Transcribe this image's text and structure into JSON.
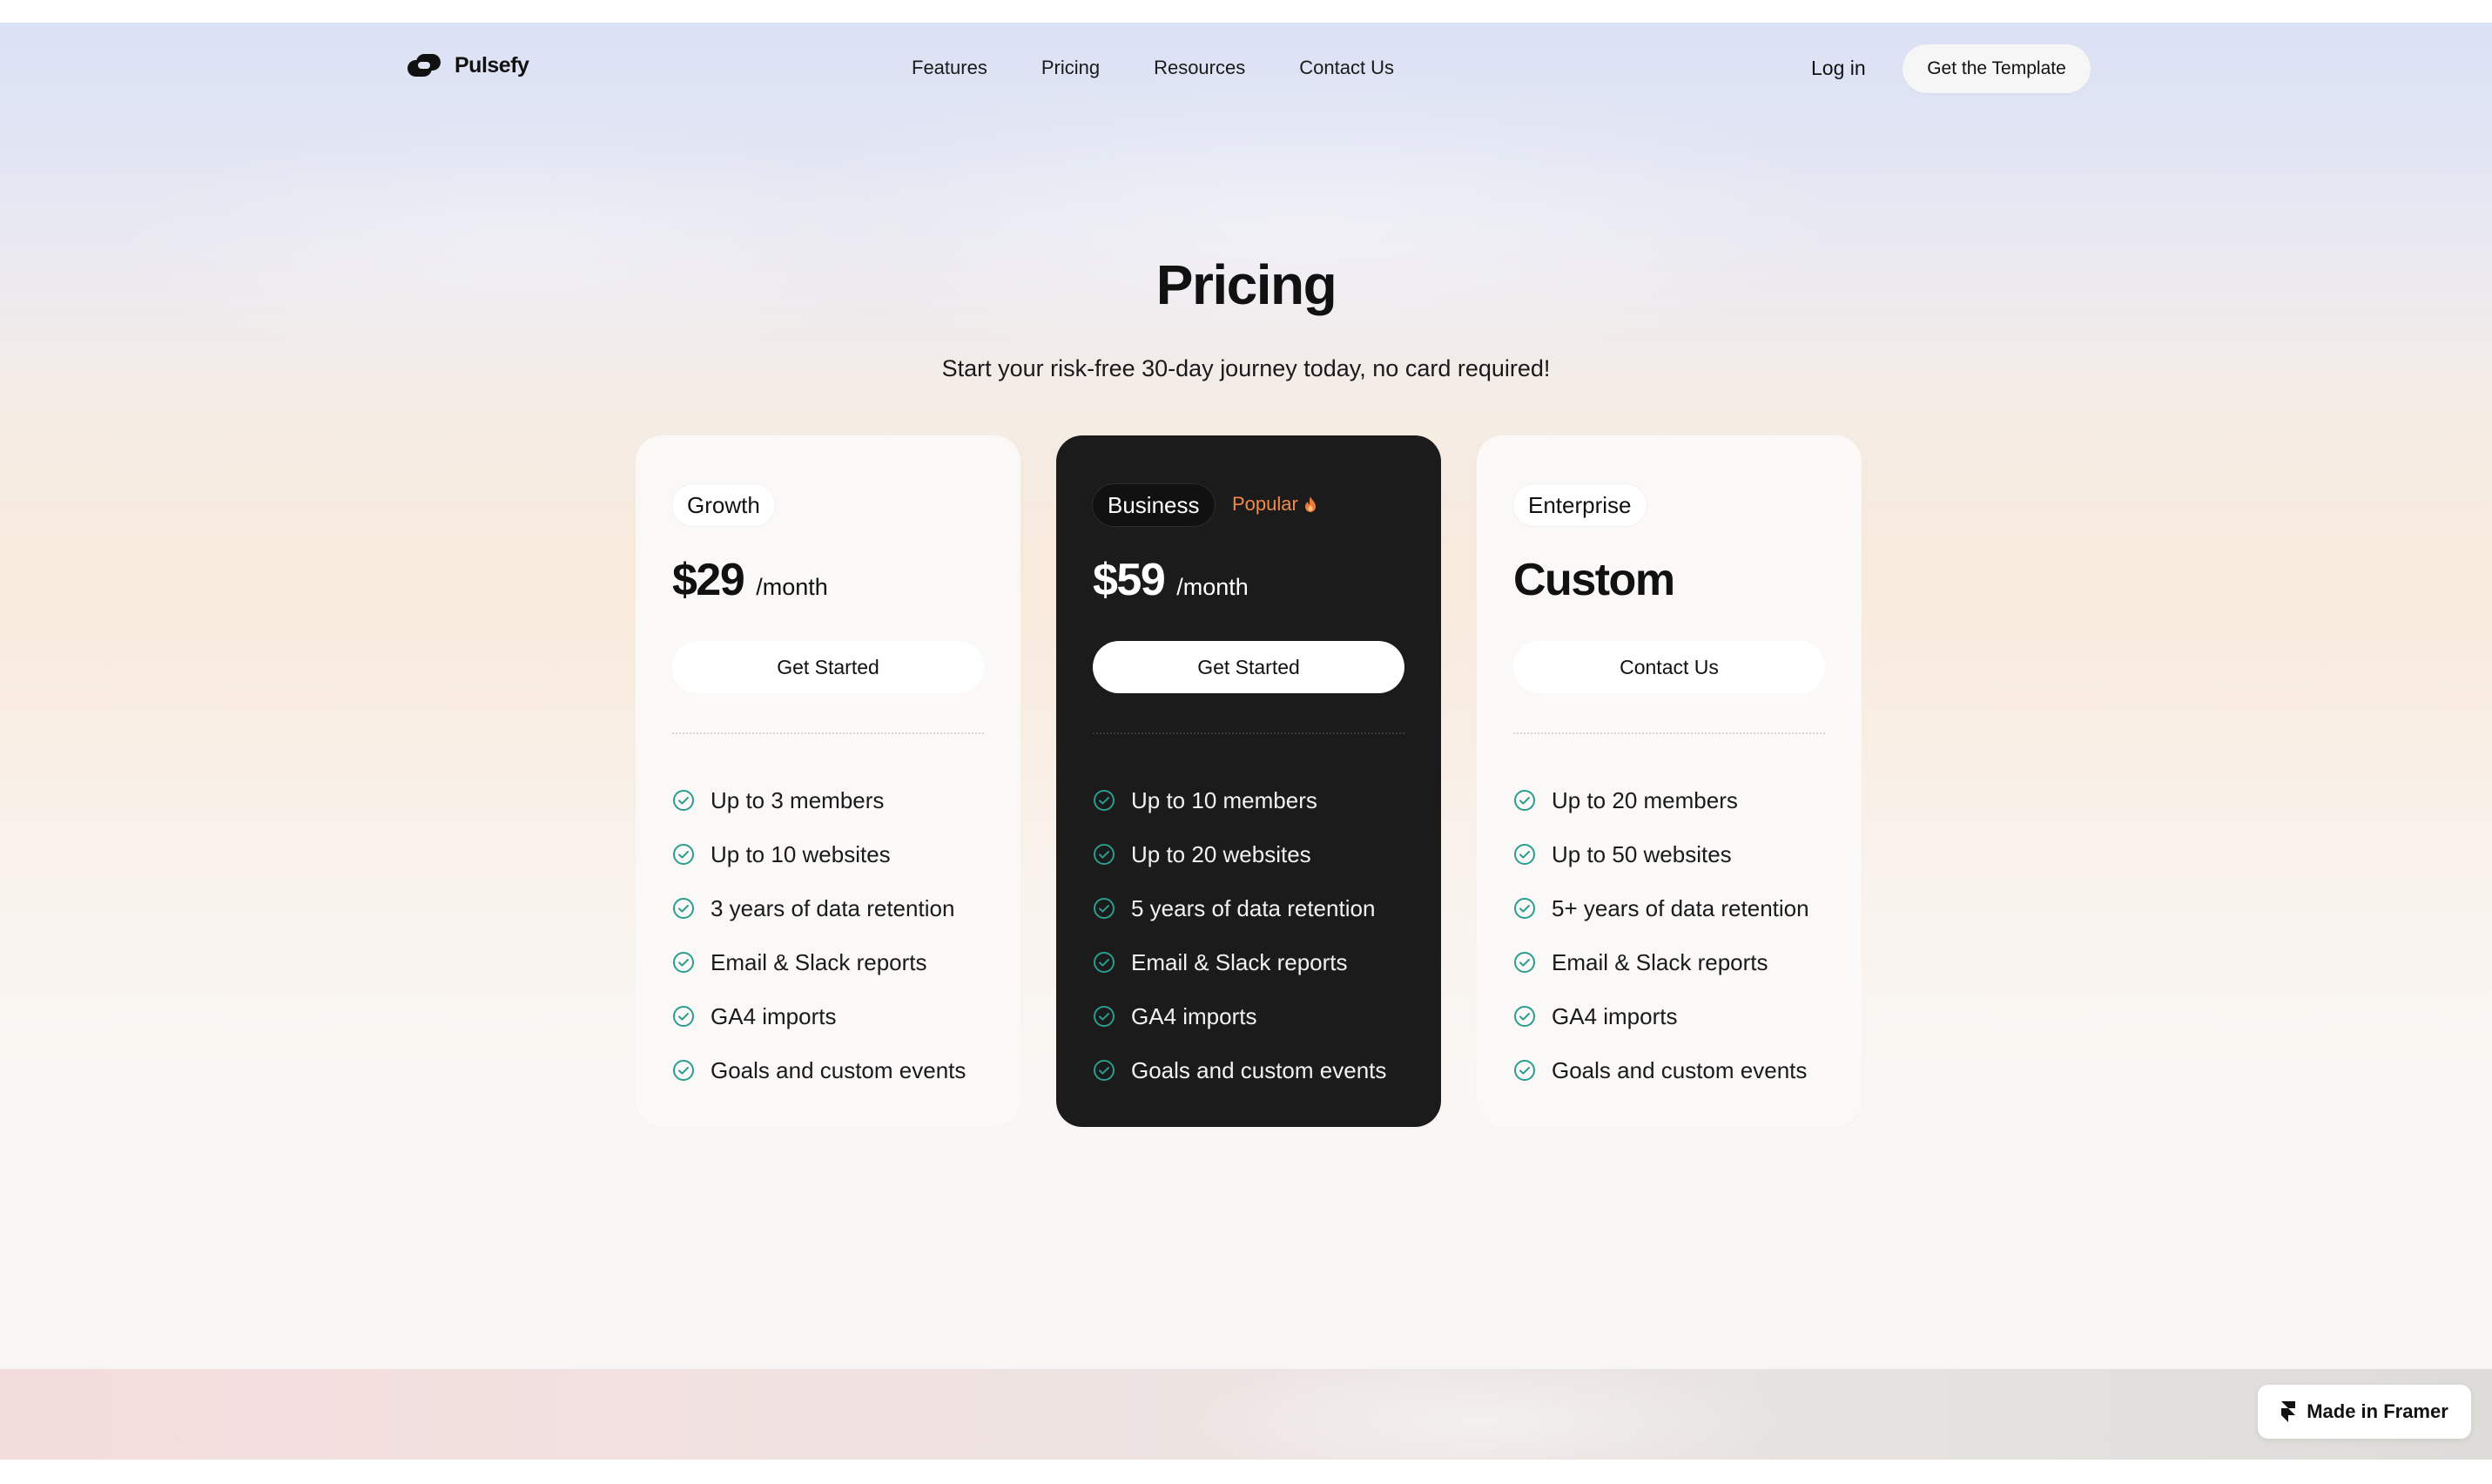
{
  "brand": {
    "name": "Pulsefy"
  },
  "nav": {
    "links": [
      {
        "label": "Features"
      },
      {
        "label": "Pricing"
      },
      {
        "label": "Resources"
      },
      {
        "label": "Contact Us"
      }
    ],
    "login_label": "Log in",
    "template_label": "Get the Template"
  },
  "pricing": {
    "title": "Pricing",
    "subtitle": "Start your risk-free 30-day journey today, no card required!",
    "plans": [
      {
        "name": "Growth",
        "price": "$29",
        "period": "/month",
        "cta": "Get Started",
        "features": [
          "Up to 3 members",
          "Up to 10 websites",
          "3 years of data retention",
          "Email & Slack reports",
          "GA4 imports",
          "Goals and custom events"
        ]
      },
      {
        "name": "Business",
        "badge": "Popular",
        "badge_icon": "fire-icon",
        "price": "$59",
        "period": "/month",
        "cta": "Get Started",
        "features": [
          "Up to 10 members",
          "Up to 20 websites",
          "5 years of data retention",
          "Email & Slack reports",
          "GA4 imports",
          "Goals and custom events"
        ]
      },
      {
        "name": "Enterprise",
        "price": "Custom",
        "cta": "Contact Us",
        "features": [
          "Up to 20 members",
          "Up to 50 websites",
          "5+ years of data retention",
          "Email & Slack reports",
          "GA4 imports",
          "Goals and custom events"
        ]
      }
    ]
  },
  "framer_badge": {
    "label": "Made in Framer",
    "icon": "framer-icon"
  },
  "colors": {
    "accent_check": "#2a9d8f",
    "popular": "#f08a4b",
    "dark_card": "#1b1b1b"
  }
}
